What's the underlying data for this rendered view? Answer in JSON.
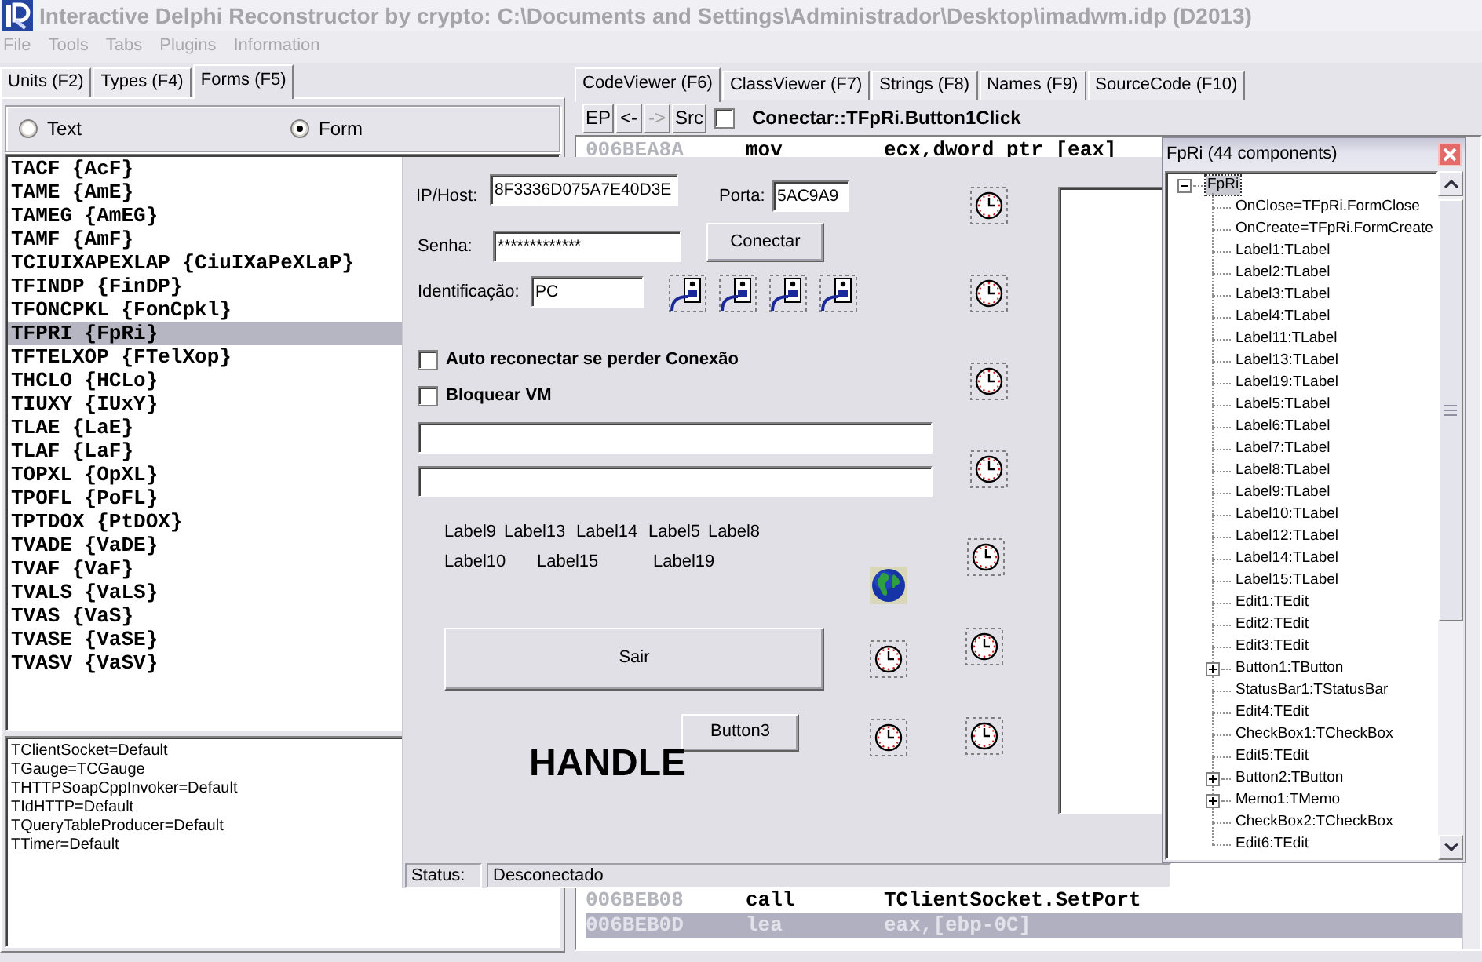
{
  "window": {
    "title": "Interactive Delphi Reconstructor by crypto: C:\\Documents and Settings\\Administrador\\Desktop\\imadwm.idp (D2013)",
    "active": false
  },
  "menu": [
    {
      "label": "File",
      "disabled": true
    },
    {
      "label": "Tools",
      "disabled": true
    },
    {
      "label": "Tabs",
      "disabled": true
    },
    {
      "label": "Plugins",
      "disabled": true
    },
    {
      "label": "Information",
      "disabled": true
    }
  ],
  "left_panel": {
    "tabs": [
      {
        "label": "Units (F2)",
        "selected": false
      },
      {
        "label": "Types (F4)",
        "selected": false
      },
      {
        "label": "Forms (F5)",
        "selected": true
      }
    ],
    "view_options": [
      {
        "label": "Text",
        "selected": false
      },
      {
        "label": "Form",
        "selected": true
      }
    ],
    "forms": [
      {
        "label": "TACF {AcF}",
        "selected": false
      },
      {
        "label": "TAME {AmE}",
        "selected": false
      },
      {
        "label": "TAMEG {AmEG}",
        "selected": false
      },
      {
        "label": "TAMF {AmF}",
        "selected": false
      },
      {
        "label": "TCIUIXAPEXLAP {CiuIXaPeXLaP}",
        "selected": false
      },
      {
        "label": "TFINDP {FinDP}",
        "selected": false
      },
      {
        "label": "TFONCPKL {FonCpkl}",
        "selected": false
      },
      {
        "label": "TFPRI {FpRi}",
        "selected": true
      },
      {
        "label": "TFTELXOP {FTelXop}",
        "selected": false
      },
      {
        "label": "THCLO {HCLo}",
        "selected": false
      },
      {
        "label": "TIUXY {IUxY}",
        "selected": false
      },
      {
        "label": "TLAE {LaE}",
        "selected": false
      },
      {
        "label": "TLAF {LaF}",
        "selected": false
      },
      {
        "label": "TOPXL {OpXL}",
        "selected": false
      },
      {
        "label": "TPOFL {PoFL}",
        "selected": false
      },
      {
        "label": "TPTDOX {PtDOX}",
        "selected": false
      },
      {
        "label": "TVADE {VaDE}",
        "selected": false
      },
      {
        "label": "TVAF {VaF}",
        "selected": false
      },
      {
        "label": "TVALS {VaLS}",
        "selected": false
      },
      {
        "label": "TVAS {VaS}",
        "selected": false
      },
      {
        "label": "TVASE {VaSE}",
        "selected": false
      },
      {
        "label": "TVASV {VaSV}",
        "selected": false
      }
    ],
    "form_info": [
      "TClientSocket=Default",
      "TGauge=TCGauge",
      "THTTPSoapCppInvoker=Default",
      "TIdHTTP=Default",
      "TQueryTableProducer=Default",
      "TTimer=Default"
    ]
  },
  "right_panel": {
    "tabs": [
      {
        "label": "CodeViewer (F6)",
        "selected": true
      },
      {
        "label": "ClassViewer (F7)",
        "selected": false
      },
      {
        "label": "Strings (F8)",
        "selected": false
      },
      {
        "label": "Names (F9)",
        "selected": false
      },
      {
        "label": "SourceCode (F10)",
        "selected": false
      }
    ],
    "toolbar": {
      "buttons": [
        {
          "label": "EP",
          "disabled": false
        },
        {
          "label": "<-",
          "disabled": false
        },
        {
          "label": "->",
          "disabled": true
        },
        {
          "label": "Src",
          "disabled": false
        }
      ],
      "checkbox": {
        "checked": false
      },
      "procedure": "Conectar::TFpRi.Button1Click"
    },
    "code_lines": [
      {
        "address": "006BEA8A",
        "mnemonic": "mov",
        "operands": "ecx,dword ptr [eax]",
        "selected": false
      },
      {
        "address": "006BEB08",
        "mnemonic": "call",
        "operands": "TClientSocket.SetPort",
        "selected": false
      },
      {
        "address": "006BEB0D",
        "mnemonic": "lea",
        "operands": "eax,[ebp-0C]",
        "selected": true
      }
    ]
  },
  "form_preview": {
    "components": [
      {
        "kind": "label",
        "text": "IP/Host:"
      },
      {
        "kind": "edit",
        "value": "8F3336D075A7E40D3E"
      },
      {
        "kind": "label",
        "text": "Porta:"
      },
      {
        "kind": "edit",
        "value": "5AC9A9"
      },
      {
        "kind": "label",
        "text": "Senha:"
      },
      {
        "kind": "edit",
        "value": "*************"
      },
      {
        "kind": "button",
        "label": "Conectar"
      },
      {
        "kind": "label",
        "text": "Identificação:"
      },
      {
        "kind": "edit",
        "value": "PC"
      },
      {
        "kind": "checkbox",
        "label": "Auto reconectar se perder Conexão",
        "checked": false
      },
      {
        "kind": "checkbox",
        "label": "Bloquear VM",
        "checked": false
      },
      {
        "kind": "edit"
      },
      {
        "kind": "edit"
      },
      {
        "kind": "label",
        "text": "Label9"
      },
      {
        "kind": "label",
        "text": "Label13"
      },
      {
        "kind": "label",
        "text": "Label14"
      },
      {
        "kind": "label",
        "text": "Label5"
      },
      {
        "kind": "label",
        "text": "Label8"
      },
      {
        "kind": "label",
        "text": "Label10"
      },
      {
        "kind": "label",
        "text": "Label15"
      },
      {
        "kind": "label",
        "text": "Label19"
      },
      {
        "kind": "button",
        "label": "Sair"
      },
      {
        "kind": "button",
        "label": "Button3"
      },
      {
        "kind": "heading",
        "text": "HANDLE"
      },
      {
        "kind": "memo"
      }
    ],
    "status_bar": [
      "Status:",
      "Desconectado"
    ]
  },
  "component_tree": {
    "title": "FpRi (44 components)",
    "nodes": [
      {
        "label": "FpRi",
        "kind": "branch",
        "expanded": true,
        "selected": true,
        "children": [
          {
            "label": "OnClose=TFpRi.FormClose",
            "kind": "leaf",
            "selected": false
          },
          {
            "label": "OnCreate=TFpRi.FormCreate",
            "kind": "leaf",
            "selected": false
          },
          {
            "label": "Label1:TLabel",
            "kind": "leaf",
            "selected": false
          },
          {
            "label": "Label2:TLabel",
            "kind": "leaf",
            "selected": false
          },
          {
            "label": "Label3:TLabel",
            "kind": "leaf",
            "selected": false
          },
          {
            "label": "Label4:TLabel",
            "kind": "leaf",
            "selected": false
          },
          {
            "label": "Label11:TLabel",
            "kind": "leaf",
            "selected": false
          },
          {
            "label": "Label13:TLabel",
            "kind": "leaf",
            "selected": false
          },
          {
            "label": "Label19:TLabel",
            "kind": "leaf",
            "selected": false
          },
          {
            "label": "Label5:TLabel",
            "kind": "leaf",
            "selected": false
          },
          {
            "label": "Label6:TLabel",
            "kind": "leaf",
            "selected": false
          },
          {
            "label": "Label7:TLabel",
            "kind": "leaf",
            "selected": false
          },
          {
            "label": "Label8:TLabel",
            "kind": "leaf",
            "selected": false
          },
          {
            "label": "Label9:TLabel",
            "kind": "leaf",
            "selected": false
          },
          {
            "label": "Label10:TLabel",
            "kind": "leaf",
            "selected": false
          },
          {
            "label": "Label12:TLabel",
            "kind": "leaf",
            "selected": false
          },
          {
            "label": "Label14:TLabel",
            "kind": "leaf",
            "selected": false
          },
          {
            "label": "Label15:TLabel",
            "kind": "leaf",
            "selected": false
          },
          {
            "label": "Edit1:TEdit",
            "kind": "leaf",
            "selected": false
          },
          {
            "label": "Edit2:TEdit",
            "kind": "leaf",
            "selected": false
          },
          {
            "label": "Edit3:TEdit",
            "kind": "leaf",
            "selected": false
          },
          {
            "label": "Button1:TButton",
            "kind": "branch",
            "expanded": false,
            "selected": false
          },
          {
            "label": "StatusBar1:TStatusBar",
            "kind": "leaf",
            "selected": false
          },
          {
            "label": "Edit4:TEdit",
            "kind": "leaf",
            "selected": false
          },
          {
            "label": "CheckBox1:TCheckBox",
            "kind": "leaf",
            "selected": false
          },
          {
            "label": "Edit5:TEdit",
            "kind": "leaf",
            "selected": false
          },
          {
            "label": "Button2:TButton",
            "kind": "branch",
            "expanded": false,
            "selected": false
          },
          {
            "label": "Memo1:TMemo",
            "kind": "branch",
            "expanded": false,
            "selected": false
          },
          {
            "label": "CheckBox2:TCheckBox",
            "kind": "leaf",
            "selected": false
          },
          {
            "label": "Edit6:TEdit",
            "kind": "leaf",
            "selected": false
          }
        ]
      }
    ]
  }
}
